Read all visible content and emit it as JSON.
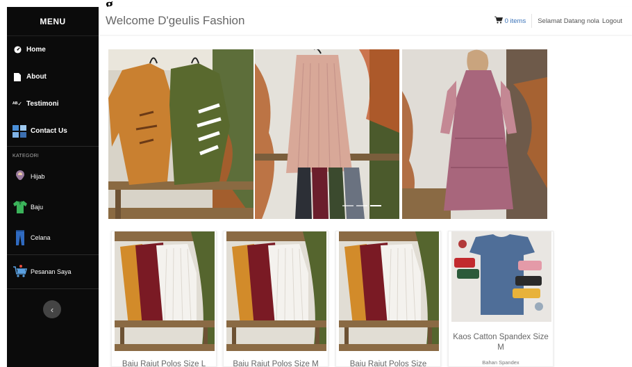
{
  "stray_heading": "g",
  "sidebar": {
    "title": "MENU",
    "nav": [
      {
        "label": "Home",
        "icon": "dashboard-icon"
      },
      {
        "label": "About",
        "icon": "file-icon"
      },
      {
        "label": "Testimoni",
        "icon": "spellcheck-icon"
      },
      {
        "label": "Contact Us",
        "icon": "contact-icon"
      }
    ],
    "category_label": "KATEGORI",
    "categories": [
      {
        "label": "Hijab",
        "icon": "hijab-icon"
      },
      {
        "label": "Baju",
        "icon": "shirt-icon"
      },
      {
        "label": "Celana",
        "icon": "pants-icon"
      }
    ],
    "orders": {
      "label": "Pesanan Saya",
      "icon": "shopping-cart-icon"
    },
    "toggle_glyph": "‹"
  },
  "header": {
    "brand": "Welcome D'geulis Fashion",
    "cart": "0 items",
    "greeting": "Selamat Datang nola",
    "logout": "Logout"
  },
  "carousel": {
    "slides": [
      {
        "name": "slide-long-sleeve-tees"
      },
      {
        "name": "slide-pleated-skirt"
      },
      {
        "name": "slide-pink-dress"
      }
    ],
    "active_index": 2,
    "count": 3
  },
  "products": [
    {
      "name": "Baju Rajut Polos Size L",
      "sub": ""
    },
    {
      "name": "Baju Rajut Polos Size M",
      "sub": ""
    },
    {
      "name": "Baju Rajut Polos Size",
      "sub": ""
    },
    {
      "name": "Kaos Catton Spandex Size M",
      "sub": "Bahan Spandex"
    }
  ],
  "colors": {
    "sidebar_bg": "#0b0b0b",
    "link": "#3b73b9"
  }
}
